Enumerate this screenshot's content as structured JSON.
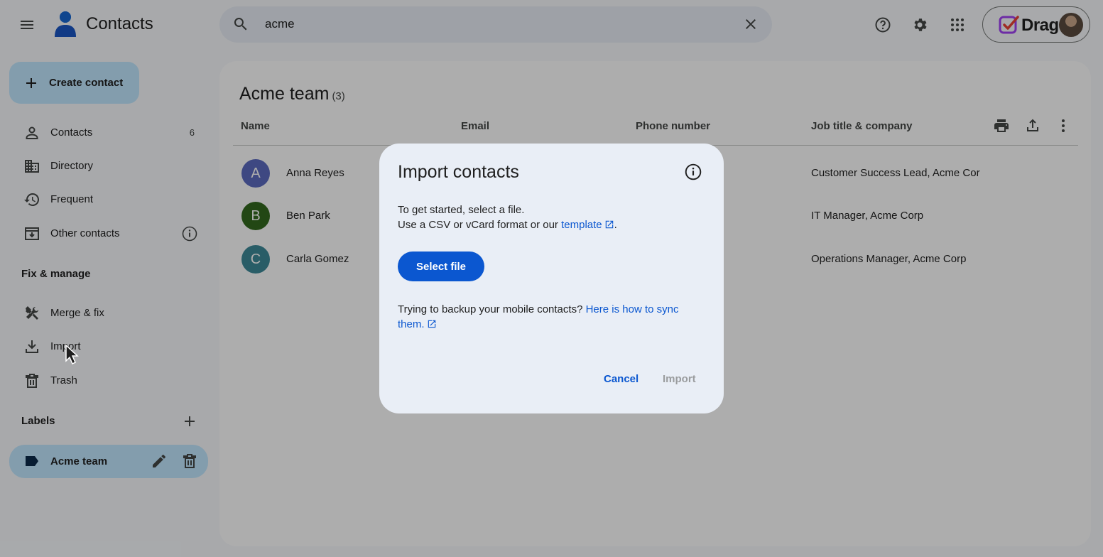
{
  "header": {
    "app_title": "Contacts",
    "search_value": "acme",
    "account_label": "Drag"
  },
  "sidebar": {
    "create_label": "Create contact",
    "nav": [
      {
        "label": "Contacts",
        "count": "6"
      },
      {
        "label": "Directory"
      },
      {
        "label": "Frequent"
      },
      {
        "label": "Other contacts"
      }
    ],
    "fix_manage_heading": "Fix & manage",
    "fix_items": [
      {
        "label": "Merge & fix"
      },
      {
        "label": "Import"
      },
      {
        "label": "Trash"
      }
    ],
    "labels_heading": "Labels",
    "labels": [
      {
        "label": "Acme team"
      }
    ]
  },
  "main": {
    "title": "Acme team",
    "count": "(3)",
    "columns": [
      "Name",
      "Email",
      "Phone number",
      "Job title & company"
    ],
    "rows": [
      {
        "initial": "A",
        "name": "Anna Reyes",
        "job": "Customer Success Lead, Acme Corp",
        "color": "#5c6bc0"
      },
      {
        "initial": "B",
        "name": "Ben Park",
        "job": "IT Manager, Acme Corp",
        "color": "#33691e"
      },
      {
        "initial": "C",
        "name": "Carla Gomez",
        "job": "Operations Manager, Acme Corp",
        "color": "#3d8a99"
      }
    ]
  },
  "dialog": {
    "title": "Import contacts",
    "line1": "To get started, select a file.",
    "line2_prefix": "Use a CSV or vCard format or our",
    "template_link": "template",
    "line2_suffix": ".",
    "select_file": "Select file",
    "backup_prefix": "Trying to backup your mobile contacts?",
    "backup_link_1": "Here is how to sync",
    "backup_link_2": "them.",
    "cancel": "Cancel",
    "import": "Import"
  },
  "colors": {
    "accent": "#0b57d0",
    "selected_bg": "#c2e7ff",
    "surface": "#f8fafd",
    "dialog_bg": "#e9eef6"
  },
  "icons": {
    "header": [
      "menu-icon",
      "contacts-logo-icon",
      "search-icon",
      "clear-icon",
      "help-icon",
      "settings-gear-icon",
      "apps-grid-icon"
    ],
    "sidebar": [
      "person-icon",
      "directory-building-icon",
      "history-icon",
      "archive-download-icon",
      "info-icon",
      "merge-tools-icon",
      "download-icon",
      "trash-icon",
      "add-icon",
      "label-tag-icon",
      "edit-pencil-icon"
    ],
    "main": [
      "print-icon",
      "export-upload-icon",
      "more-vert-icon"
    ]
  }
}
